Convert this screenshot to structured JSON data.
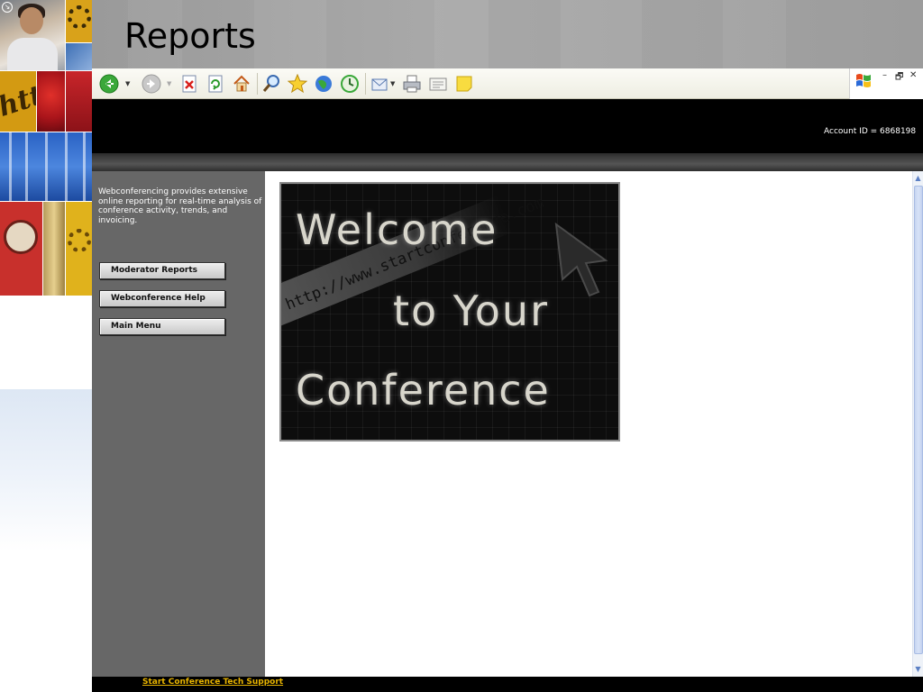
{
  "slide": {
    "title": "Reports"
  },
  "header": {
    "account_id": "Account ID = 6868198"
  },
  "nav": {
    "description": "Webconferencing provides extensive online reporting for real-time analysis of conference activity, trends, and invoicing.",
    "buttons": [
      {
        "label": "Moderator Reports"
      },
      {
        "label": "Webconference Help"
      },
      {
        "label": "Main Menu"
      }
    ]
  },
  "banner": {
    "line1": "Welcome",
    "line2": "to Your",
    "line3": "Conference",
    "url_text": "http://www.startconference.com"
  },
  "footer": {
    "tech_support_link": "Start Conference Tech Support"
  },
  "toolbar": {
    "icons": [
      "back-icon",
      "forward-icon",
      "stop-icon",
      "refresh-icon",
      "home-icon",
      "search-icon",
      "favorites-icon",
      "media-icon",
      "history-icon",
      "mail-icon",
      "print-icon",
      "edit-icon",
      "note-icon"
    ]
  },
  "window_controls": {
    "minimize": "–",
    "restore": "🗗",
    "close": "✕"
  },
  "colors": {
    "header_bg": "#000000",
    "nav_bg": "#676767",
    "link": "#e8b400",
    "title_band": "#a0a0a0"
  }
}
